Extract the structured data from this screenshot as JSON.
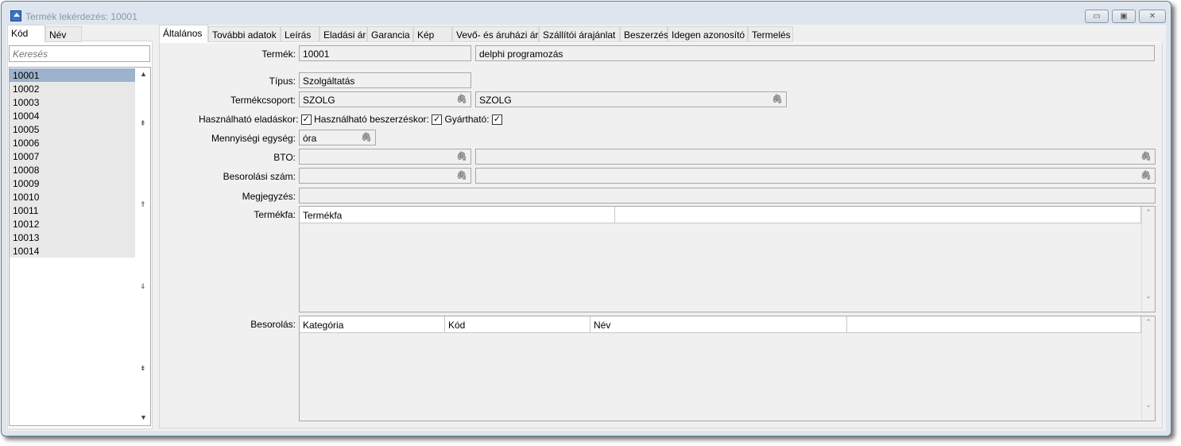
{
  "window": {
    "title": "Termék lekérdezés: 10001",
    "minimize": "▭",
    "maximize": "▣",
    "close": "✕"
  },
  "left": {
    "tabs": [
      "Kód",
      "Név"
    ],
    "search_placeholder": "Keresés",
    "items": [
      "10001",
      "10002",
      "10003",
      "10004",
      "10005",
      "10006",
      "10007",
      "10008",
      "10009",
      "10010",
      "10011",
      "10012",
      "10013",
      "10014"
    ]
  },
  "tabs": [
    "Általános",
    "További adatok",
    "Leírás",
    "Eladási ár",
    "Garancia",
    "Kép",
    "Vevő- és áruházi ár",
    "Szállítói árajánlat",
    "Beszerzés",
    "Idegen azonosító",
    "Termelés"
  ],
  "form": {
    "termek_label": "Termék:",
    "termek_code": "10001",
    "termek_name": "delphi programozás",
    "tipus_label": "Típus:",
    "tipus_value": "Szolgáltatás",
    "csoport_label": "Termékcsoport:",
    "csoport_code": "SZOLG",
    "csoport_name": "SZOLG",
    "elad_label": "Használható eladáskor:",
    "elad_checked": true,
    "besz_label": "Használható beszerzéskor:",
    "besz_checked": true,
    "gyart_label": "Gyártható:",
    "gyart_checked": true,
    "menny_label": "Mennyiségi egység:",
    "menny_value": "óra",
    "bto_label": "BTO:",
    "bto_code": "",
    "bto_name": "",
    "besorszam_label": "Besorolási szám:",
    "besorszam_code": "",
    "besorszam_name": "",
    "megj_label": "Megjegyzés:",
    "megj_value": "",
    "termekfa_label": "Termékfa:",
    "termekfa_cols": [
      "Termékfa",
      ""
    ],
    "besorolas_label": "Besorolás:",
    "besorolas_cols": [
      "Kategória",
      "Kód",
      "Név",
      ""
    ]
  }
}
